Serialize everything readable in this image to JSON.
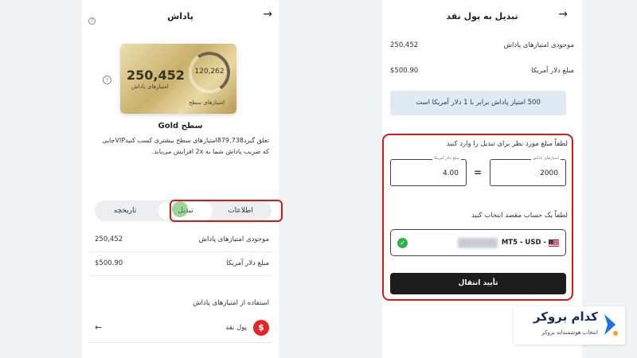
{
  "left_panel": {
    "title": "پاداش",
    "help_glyph": "?",
    "card": {
      "points": "250,452",
      "points_label": "امتیازهای پاداش",
      "level_points": "120,262",
      "level_label": "امتیازهای سطح"
    },
    "level_title": "سطح Gold",
    "level_desc": "تعلق گیرد879,738امتیازهای سطح بیشتری کسب کنیدVIPجایی که ضریب پاداش شما به 2x افزایش می‌یابد.",
    "tabs": {
      "info": "اطلاعات",
      "cash": "تبدیل",
      "history": "تاریخچه"
    },
    "rows": [
      {
        "label": "موجودی امتیازهای پاداش",
        "value": "250,452"
      },
      {
        "label": "مبلغ دلار آمریکا",
        "value": "$500.90"
      }
    ],
    "use_title": "استفاده از امتیازهای پاداش",
    "cash_option": {
      "icon": "dollar-icon",
      "glyph": "$",
      "label": "پول نقد",
      "chevron": "←"
    }
  },
  "right_panel": {
    "title": "تبدیل به پول نقد",
    "rows": [
      {
        "label": "موجودی امتیازهای پاداش",
        "value": "250,452"
      },
      {
        "label": "مبلغ دلار آمریکا",
        "value": "$500.90"
      }
    ],
    "rate_note": "500 امتیاز پاداش برابر با 1 دلار آمریکا است",
    "enter_title": "لطفاً مبلغ مورد نظر برای تبدیل را وارد کنید",
    "points_field": {
      "label": "امتیازهای پاداش",
      "value": "2000"
    },
    "dollar_field": {
      "label": "مبلغ دلار آمریکا",
      "value": "4.00"
    },
    "equals": "=",
    "select_title": "لطفاً یک حساب مقصد انتخاب کنید",
    "account": "MT5 - USD -",
    "check_glyph": "✓",
    "confirm_label": "تأیید انتقال"
  },
  "nav": {
    "back_glyph": "→"
  },
  "logo": {
    "name": "کدام بروکر",
    "tagline": "انتخاب هوشمندانه بروکر"
  },
  "colors": {
    "highlight": "#d01b1b",
    "confirm_bg": "#1c1c1c",
    "rate_bg": "#dfeaf5",
    "cash_icon": "#e02626",
    "check": "#2fb24c"
  }
}
